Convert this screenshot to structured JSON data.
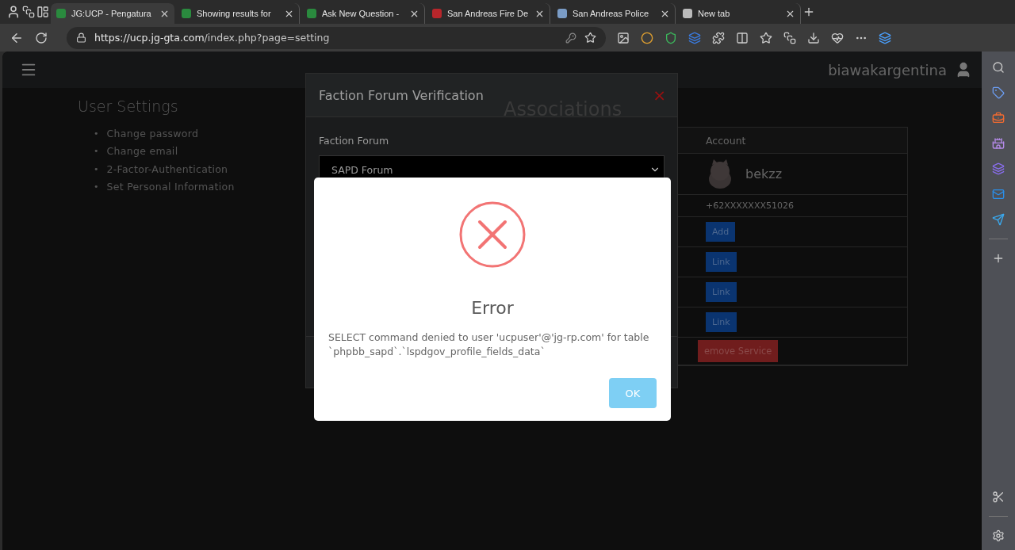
{
  "browser": {
    "tabs": [
      {
        "title": "JG:UCP - Pengatura",
        "selected": true
      },
      {
        "title": "Showing results for",
        "selected": false
      },
      {
        "title": "Ask New Question -",
        "selected": false
      },
      {
        "title": "San Andreas Fire De",
        "selected": false
      },
      {
        "title": "San Andreas Police",
        "selected": false
      },
      {
        "title": "New tab",
        "selected": false
      }
    ],
    "url_host": "https://ucp.jg-gta.com",
    "url_path": "/index.php?page=setting"
  },
  "header": {
    "username": "biawakargentina"
  },
  "settings": {
    "title": "User Settings",
    "bullet": "•",
    "links": [
      "Change password",
      "Change email",
      "2-Factor-Authentication",
      "Set Personal Information"
    ]
  },
  "associations": {
    "title": "Associations",
    "column": "Account",
    "account_name": "bekzz",
    "phone": "+62XXXXXXX51026",
    "actions": [
      {
        "label": "Add"
      },
      {
        "label": "Link"
      },
      {
        "label": "Link"
      },
      {
        "label": "Link"
      }
    ],
    "remove_label": "emove Service"
  },
  "faction_modal": {
    "title": "Faction Forum Verification",
    "close": "×",
    "field_label": "Faction Forum",
    "value": "SAPD Forum"
  },
  "error_dialog": {
    "title": "Error",
    "message": "SELECT command denied to user 'ucpuser'@'jg-rp.com' for table `phpbb_sapd`.`lspdgov_profile_fields_data`",
    "button": "OK"
  }
}
